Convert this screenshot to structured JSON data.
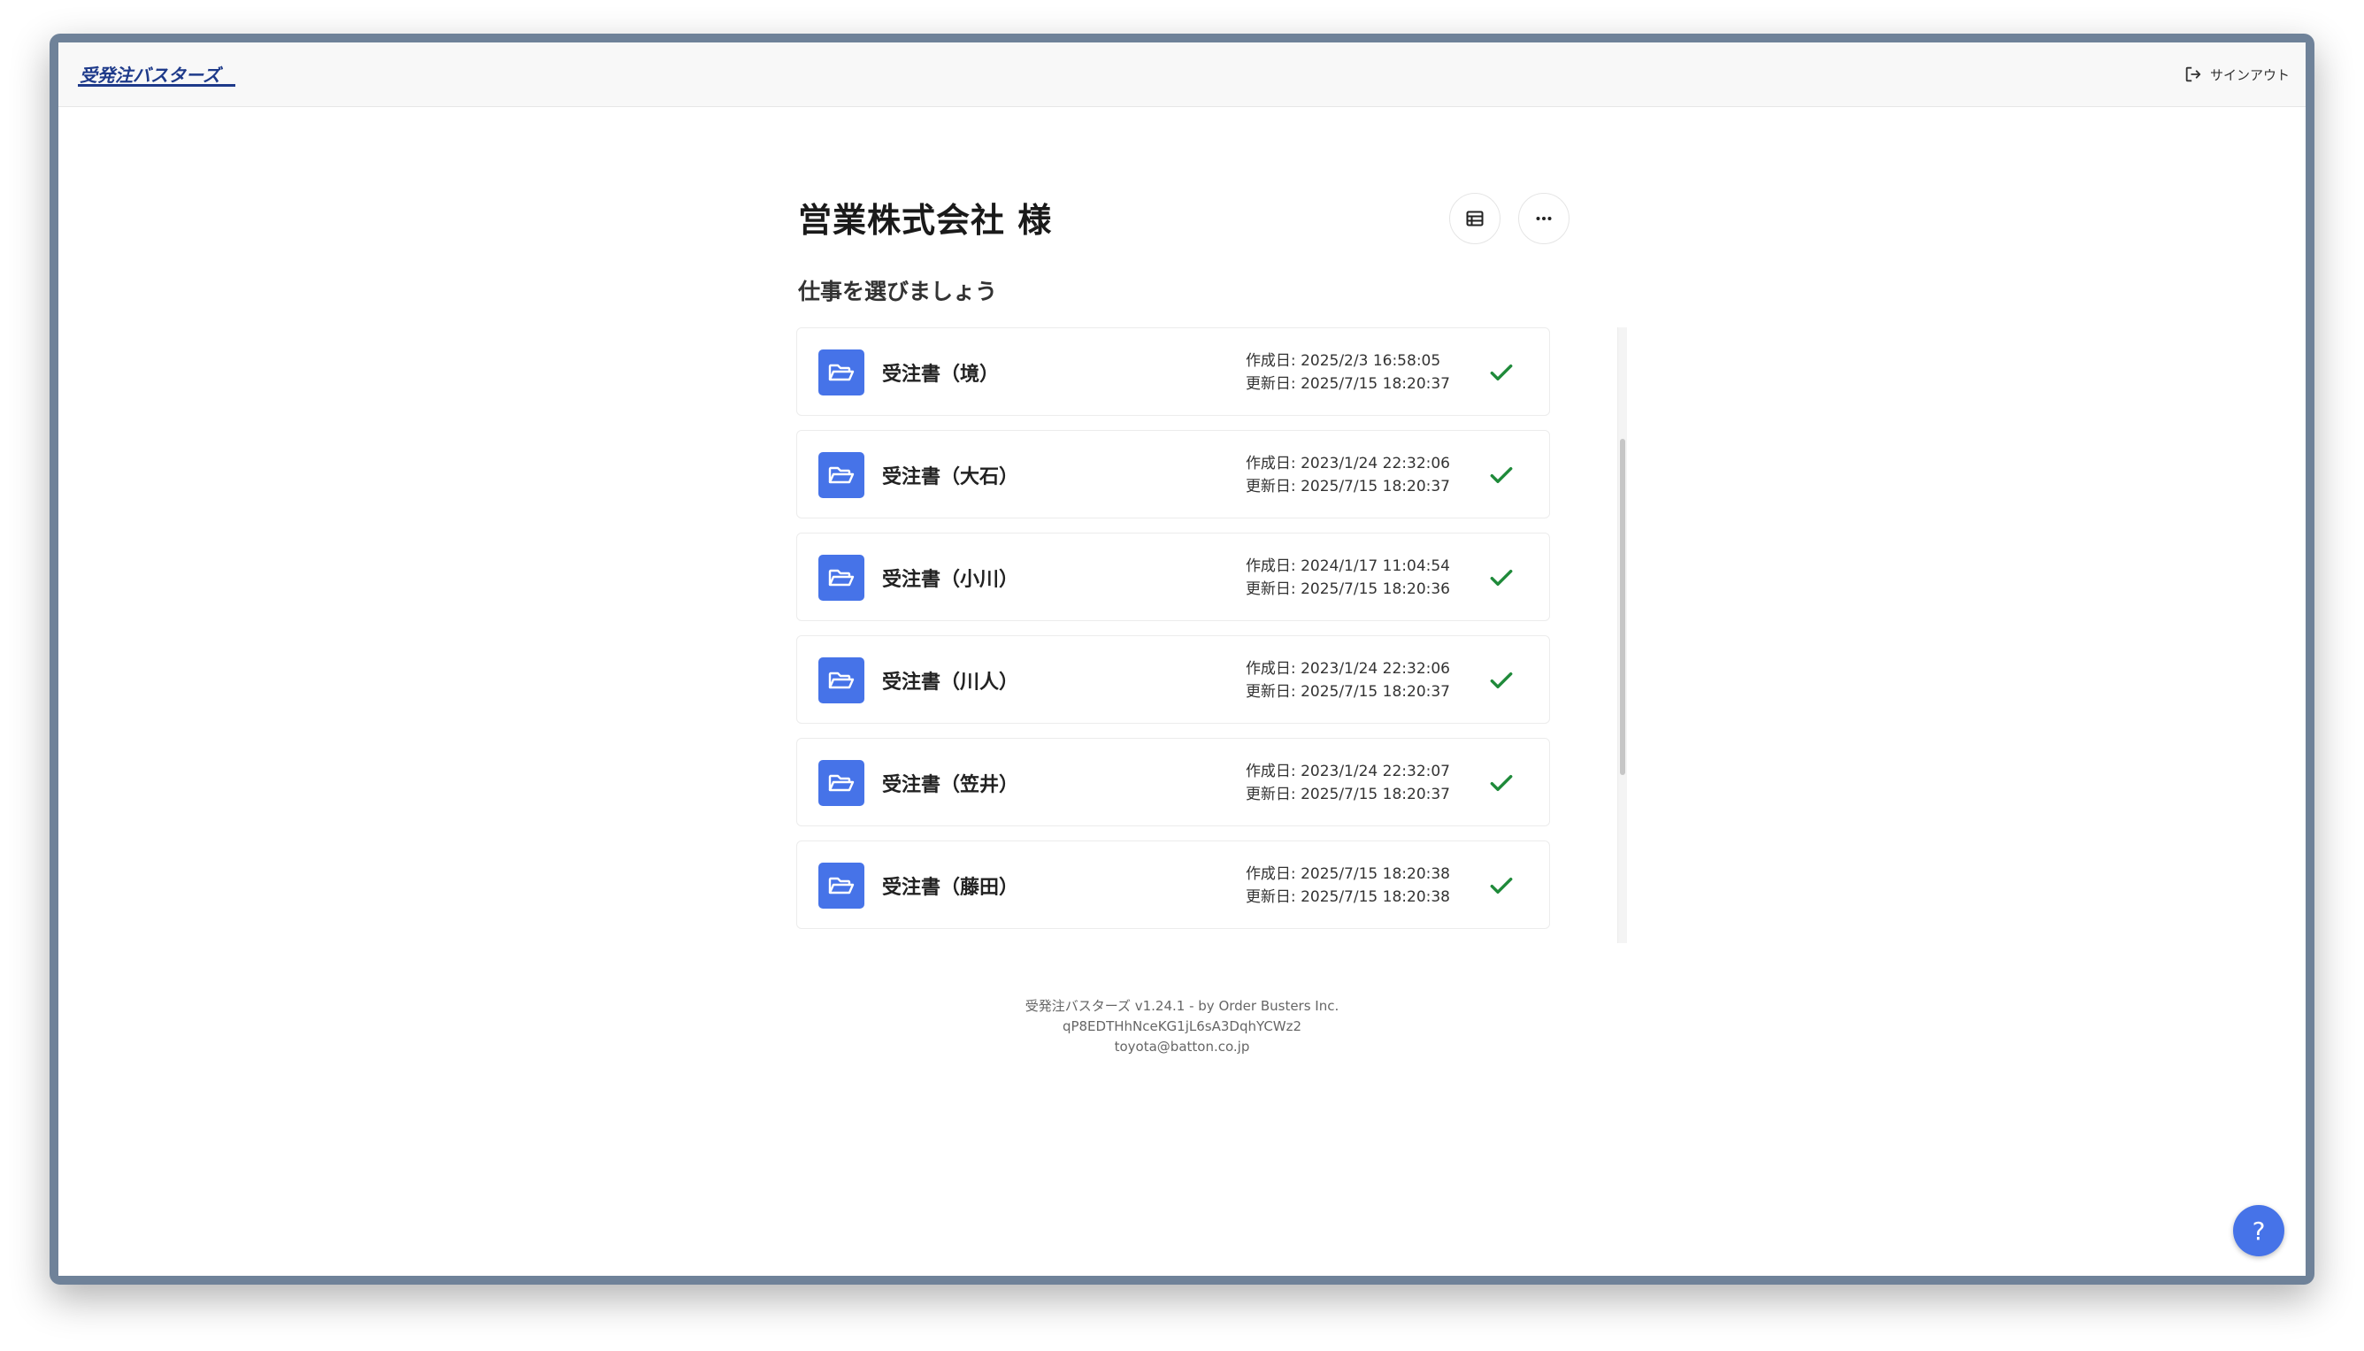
{
  "header": {
    "logo_text": "受発注バスターズ",
    "signout_label": "サインアウト"
  },
  "main": {
    "title": "営業株式会社 様",
    "subtitle": "仕事を選びましょう",
    "list_view_icon": "table-icon",
    "more_icon": "ellipsis-icon"
  },
  "jobs": [
    {
      "name": "受注書（境）",
      "created": "作成日: 2025/2/3 16:58:05",
      "updated": "更新日: 2025/7/15 18:20:37",
      "status": "done"
    },
    {
      "name": "受注書（大石）",
      "created": "作成日: 2023/1/24 22:32:06",
      "updated": "更新日: 2025/7/15 18:20:37",
      "status": "done"
    },
    {
      "name": "受注書（小川）",
      "created": "作成日: 2024/1/17 11:04:54",
      "updated": "更新日: 2025/7/15 18:20:36",
      "status": "done"
    },
    {
      "name": "受注書（川人）",
      "created": "作成日: 2023/1/24 22:32:06",
      "updated": "更新日: 2025/7/15 18:20:37",
      "status": "done"
    },
    {
      "name": "受注書（笠井）",
      "created": "作成日: 2023/1/24 22:32:07",
      "updated": "更新日: 2025/7/15 18:20:37",
      "status": "done"
    },
    {
      "name": "受注書（藤田）",
      "created": "作成日: 2025/7/15 18:20:38",
      "updated": "更新日: 2025/7/15 18:20:38",
      "status": "done"
    }
  ],
  "footer": {
    "version": "受発注バスターズ v1.24.1 - by Order Busters Inc.",
    "id": "qP8EDTHhNceKG1jL6sA3DqhYCWz2",
    "email": "toyota@batton.co.jp"
  },
  "help": {
    "label": "?"
  },
  "colors": {
    "accent": "#4673e8",
    "logo": "#1e3a8a",
    "check": "#1f8a3a",
    "frame": "#6f8299"
  }
}
